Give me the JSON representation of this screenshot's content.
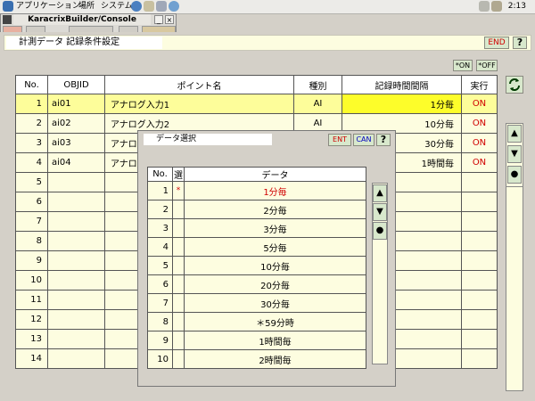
{
  "topbar": {
    "menus": [
      "アプリケーション",
      "場所",
      "システム"
    ],
    "clock": "2:13"
  },
  "console": {
    "title": "KaracrixBuilder/Console",
    "minimize": "_",
    "close": "×"
  },
  "form": {
    "title": "計測データ 記録条件設定",
    "end_label": "END",
    "help_label": "?",
    "on_label": "*ON",
    "off_label": "*OFF"
  },
  "table": {
    "headers": [
      "No.",
      "OBJID",
      "ポイント名",
      "種別",
      "記録時間間隔",
      "実行"
    ],
    "rows": [
      {
        "no": "1",
        "objid": "ai01",
        "name": "アナログ入力1",
        "kind": "AI",
        "interval": "1分毎",
        "exec": "ON"
      },
      {
        "no": "2",
        "objid": "ai02",
        "name": "アナログ入力2",
        "kind": "AI",
        "interval": "10分毎",
        "exec": "ON"
      },
      {
        "no": "3",
        "objid": "ai03",
        "name": "アナロ",
        "kind": "",
        "interval": "30分毎",
        "exec": "ON"
      },
      {
        "no": "4",
        "objid": "ai04",
        "name": "アナロ",
        "kind": "",
        "interval": "1時間毎",
        "exec": "ON"
      },
      {
        "no": "5",
        "objid": "",
        "name": "",
        "kind": "",
        "interval": "",
        "exec": ""
      },
      {
        "no": "6",
        "objid": "",
        "name": "",
        "kind": "",
        "interval": "",
        "exec": ""
      },
      {
        "no": "7",
        "objid": "",
        "name": "",
        "kind": "",
        "interval": "",
        "exec": ""
      },
      {
        "no": "8",
        "objid": "",
        "name": "",
        "kind": "",
        "interval": "",
        "exec": ""
      },
      {
        "no": "9",
        "objid": "",
        "name": "",
        "kind": "",
        "interval": "",
        "exec": ""
      },
      {
        "no": "10",
        "objid": "",
        "name": "",
        "kind": "",
        "interval": "",
        "exec": ""
      },
      {
        "no": "11",
        "objid": "",
        "name": "",
        "kind": "",
        "interval": "",
        "exec": ""
      },
      {
        "no": "12",
        "objid": "",
        "name": "",
        "kind": "",
        "interval": "",
        "exec": ""
      },
      {
        "no": "13",
        "objid": "",
        "name": "",
        "kind": "",
        "interval": "",
        "exec": ""
      },
      {
        "no": "14",
        "objid": "",
        "name": "",
        "kind": "",
        "interval": "",
        "exec": ""
      }
    ]
  },
  "nav": {
    "up": "▲",
    "down": "▼",
    "dot": "●"
  },
  "popup": {
    "title": "データ選択",
    "ent_label": "ENT",
    "can_label": "CAN",
    "help_label": "?",
    "headers": [
      "No.",
      "選",
      "データ"
    ],
    "rows": [
      {
        "no": "1",
        "mark": "*",
        "value": "1分毎"
      },
      {
        "no": "2",
        "mark": "",
        "value": "2分毎"
      },
      {
        "no": "3",
        "mark": "",
        "value": "3分毎"
      },
      {
        "no": "4",
        "mark": "",
        "value": "5分毎"
      },
      {
        "no": "5",
        "mark": "",
        "value": "10分毎"
      },
      {
        "no": "6",
        "mark": "",
        "value": "20分毎"
      },
      {
        "no": "7",
        "mark": "",
        "value": "30分毎"
      },
      {
        "no": "8",
        "mark": "",
        "value": "＊59分時"
      },
      {
        "no": "9",
        "mark": "",
        "value": "1時間毎"
      },
      {
        "no": "10",
        "mark": "",
        "value": "2時間毎"
      }
    ]
  },
  "colors": {
    "panel": "#d4d0c8",
    "cell": "#fdfde0",
    "selected_row": "#fdfd9a",
    "selected_cell": "#fdfd2a",
    "button": "#d8e8cc",
    "accent_red": "#d00000",
    "accent_blue": "#0000c0"
  }
}
